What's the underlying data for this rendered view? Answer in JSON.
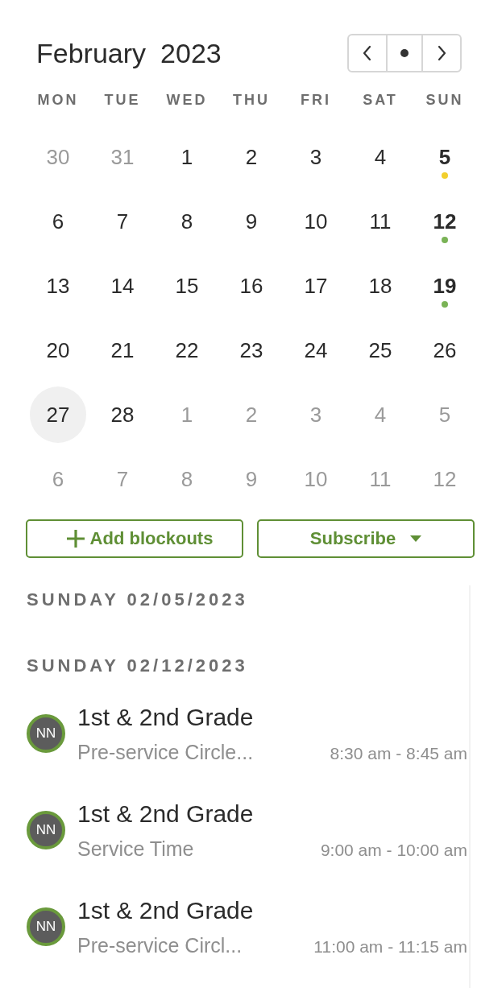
{
  "calendar": {
    "month": "February",
    "year": "2023",
    "weekdays": [
      "MON",
      "TUE",
      "WED",
      "THU",
      "FRI",
      "SAT",
      "SUN"
    ],
    "days": [
      {
        "label": "30",
        "in_month": false,
        "selected": false
      },
      {
        "label": "31",
        "in_month": false,
        "selected": false
      },
      {
        "label": "1",
        "in_month": true,
        "selected": false
      },
      {
        "label": "2",
        "in_month": true,
        "selected": false
      },
      {
        "label": "3",
        "in_month": true,
        "selected": false
      },
      {
        "label": "4",
        "in_month": true,
        "selected": false
      },
      {
        "label": "5",
        "in_month": true,
        "selected": false,
        "color": "#f2cf2c"
      },
      {
        "label": "6",
        "in_month": true,
        "selected": false
      },
      {
        "label": "7",
        "in_month": true,
        "selected": false
      },
      {
        "label": "8",
        "in_month": true,
        "selected": false
      },
      {
        "label": "9",
        "in_month": true,
        "selected": false
      },
      {
        "label": "10",
        "in_month": true,
        "selected": false
      },
      {
        "label": "11",
        "in_month": true,
        "selected": false
      },
      {
        "label": "12",
        "in_month": true,
        "selected": false,
        "color": "#7ab356"
      },
      {
        "label": "13",
        "in_month": true,
        "selected": false
      },
      {
        "label": "14",
        "in_month": true,
        "selected": false
      },
      {
        "label": "15",
        "in_month": true,
        "selected": false
      },
      {
        "label": "16",
        "in_month": true,
        "selected": false
      },
      {
        "label": "17",
        "in_month": true,
        "selected": false
      },
      {
        "label": "18",
        "in_month": true,
        "selected": false
      },
      {
        "label": "19",
        "in_month": true,
        "selected": false,
        "color": "#7ab356"
      },
      {
        "label": "20",
        "in_month": true,
        "selected": false
      },
      {
        "label": "21",
        "in_month": true,
        "selected": false
      },
      {
        "label": "22",
        "in_month": true,
        "selected": false
      },
      {
        "label": "23",
        "in_month": true,
        "selected": false
      },
      {
        "label": "24",
        "in_month": true,
        "selected": false
      },
      {
        "label": "25",
        "in_month": true,
        "selected": false
      },
      {
        "label": "26",
        "in_month": true,
        "selected": false
      },
      {
        "label": "27",
        "in_month": true,
        "selected": true
      },
      {
        "label": "28",
        "in_month": true,
        "selected": false
      },
      {
        "label": "1",
        "in_month": false,
        "selected": false
      },
      {
        "label": "2",
        "in_month": false,
        "selected": false
      },
      {
        "label": "3",
        "in_month": false,
        "selected": false
      },
      {
        "label": "4",
        "in_month": false,
        "selected": false
      },
      {
        "label": "5",
        "in_month": false,
        "selected": false
      },
      {
        "label": "6",
        "in_month": false,
        "selected": false
      },
      {
        "label": "7",
        "in_month": false,
        "selected": false
      },
      {
        "label": "8",
        "in_month": false,
        "selected": false
      },
      {
        "label": "9",
        "in_month": false,
        "selected": false
      },
      {
        "label": "10",
        "in_month": false,
        "selected": false
      },
      {
        "label": "11",
        "in_month": false,
        "selected": false
      },
      {
        "label": "12",
        "in_month": false,
        "selected": false
      }
    ]
  },
  "buttons": {
    "add": "Add blockouts",
    "subscribe": "Subscribe"
  },
  "agenda": [
    {
      "heading": "SUNDAY 02/05/2023"
    },
    {
      "heading": "SUNDAY 02/12/2023",
      "events": [
        {
          "initials": "NN",
          "title": "1st & 2nd Grade",
          "subtitle": "Pre-service Circle...",
          "time": "8:30 am - 8:45 am"
        },
        {
          "initials": "NN",
          "title": "1st & 2nd Grade",
          "subtitle": "Service Time",
          "time": "9:00 am - 10:00 am"
        },
        {
          "initials": "NN",
          "title": "1st & 2nd Grade",
          "subtitle": "Pre-service Circl...",
          "time": "11:00 am - 11:15 am"
        }
      ]
    }
  ]
}
